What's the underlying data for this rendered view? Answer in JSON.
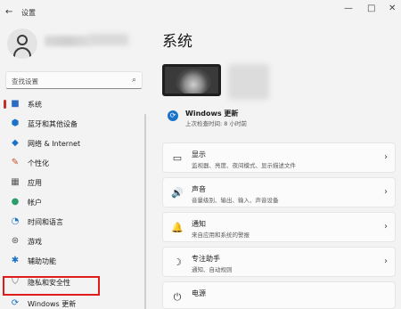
{
  "window": {
    "title": "设置",
    "back_icon": "←",
    "minimize_icon": "—",
    "maximize_icon": "□",
    "close_icon": "✕"
  },
  "sidebar": {
    "search_placeholder": "查找设置",
    "items": [
      {
        "label": "系统",
        "icon": "■"
      },
      {
        "label": "蓝牙和其他设备",
        "icon": "⬢"
      },
      {
        "label": "网络 & Internet",
        "icon": "◆"
      },
      {
        "label": "个性化",
        "icon": "✎"
      },
      {
        "label": "应用",
        "icon": "▦"
      },
      {
        "label": "帐户",
        "icon": "●"
      },
      {
        "label": "时间和语言",
        "icon": "◔"
      },
      {
        "label": "游戏",
        "icon": "⊛"
      },
      {
        "label": "辅助功能",
        "icon": "✱"
      },
      {
        "label": "隐私和安全性",
        "icon": "⛉"
      },
      {
        "label": "Windows 更新",
        "icon": "⟳"
      }
    ],
    "active_index": 0,
    "highlight_color": "#e01b1b"
  },
  "main": {
    "page_title": "系统",
    "update": {
      "title": "Windows 更新",
      "subtitle": "上次检查时间: 8 小时前"
    },
    "cards": [
      {
        "title": "显示",
        "desc": "监视器、亮度、夜间模式、显示描述文件",
        "icon": "▭"
      },
      {
        "title": "声音",
        "desc": "音量级别、输出、输入、声音设备",
        "icon": "🔊"
      },
      {
        "title": "通知",
        "desc": "来自应用和系统的警报",
        "icon": "🔔"
      },
      {
        "title": "专注助手",
        "desc": "通知、自动规则",
        "icon": "☽"
      },
      {
        "title": "电源",
        "desc": "",
        "icon": "⏻"
      }
    ]
  },
  "colors": {
    "accent": "#1a73c8",
    "active_bar": "#c2302a",
    "background": "#f3f3f3"
  }
}
